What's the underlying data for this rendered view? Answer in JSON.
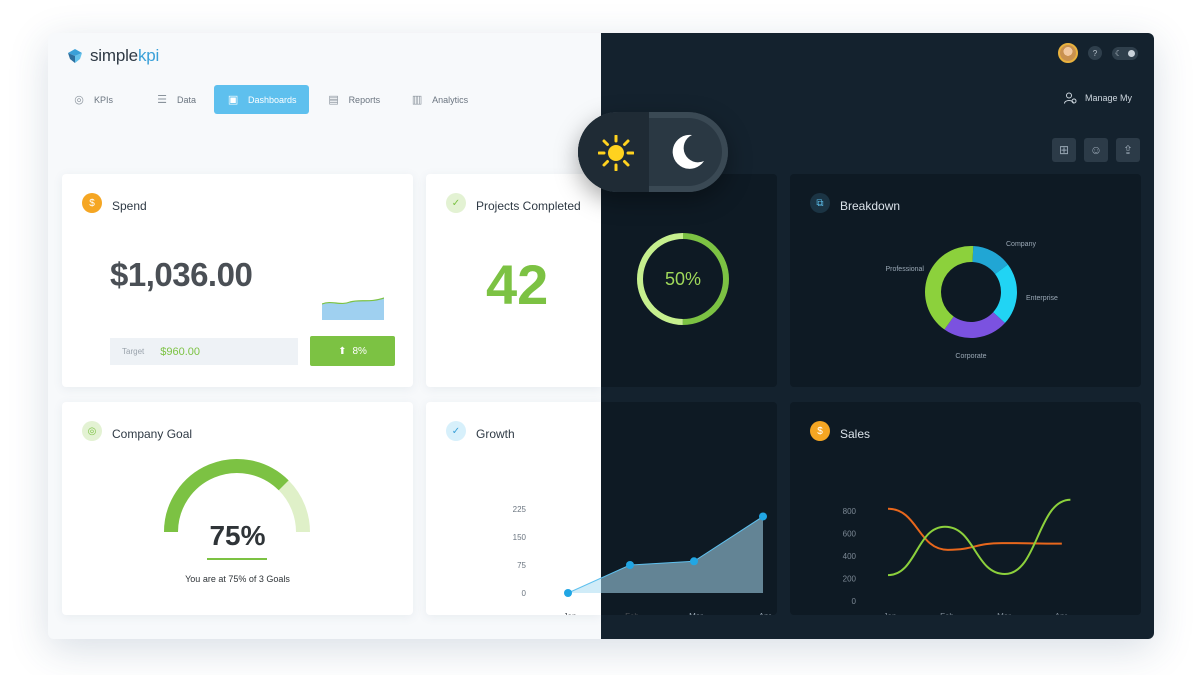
{
  "app": {
    "logo_simple": "simple",
    "logo_kpi": "kpi"
  },
  "nav": {
    "items": [
      {
        "label": "KPIs",
        "icon": "target-icon"
      },
      {
        "label": "Data",
        "icon": "data-icon"
      },
      {
        "label": "Dashboards",
        "icon": "dashboard-icon",
        "active": true
      },
      {
        "label": "Reports",
        "icon": "reports-icon"
      },
      {
        "label": "Analytics",
        "icon": "analytics-icon"
      }
    ]
  },
  "header": {
    "help": "?",
    "manage_label": "Manage My"
  },
  "colors": {
    "accent": "#5ec0ee",
    "green": "#7cc243",
    "orange": "#f5a623",
    "dark_bg": "#14222e",
    "dark_card": "#0e1a24",
    "cyan": "#21d4f4",
    "purple": "#7b52e0"
  },
  "spend": {
    "title": "Spend",
    "value": "$1,036.00",
    "target_label": "Target",
    "target_value": "$960.00",
    "change": "8%"
  },
  "projects": {
    "title": "Projects Completed",
    "value": "42",
    "percent_label": "50%",
    "percent": 50
  },
  "breakdown": {
    "title": "Breakdown"
  },
  "goal": {
    "title": "Company Goal",
    "percent_label": "75%",
    "percent": 75,
    "note": "You are at 75% of 3 Goals"
  },
  "growth": {
    "title": "Growth"
  },
  "sales": {
    "title": "Sales"
  },
  "chart_data": [
    {
      "type": "pie",
      "title": "Breakdown",
      "categories": [
        "Company",
        "Enterprise",
        "Corporate",
        "Professional"
      ],
      "values": [
        14,
        22,
        23,
        41
      ],
      "colors": [
        "#21a6d4",
        "#21d4f4",
        "#7b52e0",
        "#8cd13c"
      ]
    },
    {
      "type": "area",
      "title": "Growth",
      "categories": [
        "Jan",
        "Feb",
        "Mar",
        "Apr"
      ],
      "y_ticks": [
        "225",
        "150",
        "75",
        "0"
      ],
      "ylim": [
        0,
        225
      ],
      "values": [
        0,
        75,
        85,
        205
      ]
    },
    {
      "type": "line",
      "title": "Sales",
      "categories": [
        "Jan",
        "Feb",
        "Mar",
        "Apr"
      ],
      "y_ticks": [
        "800",
        "600",
        "400",
        "200",
        "0"
      ],
      "ylim": [
        0,
        800
      ],
      "series": [
        {
          "color": "#e8671c",
          "values": [
            820,
            455,
            515,
            510
          ],
          "x": [
            0,
            1.05,
            2.0,
            3.05
          ]
        },
        {
          "color": "#8cd13c",
          "values": [
            230,
            660,
            240,
            900
          ],
          "x": [
            0,
            1.0,
            2.05,
            3.2
          ]
        }
      ]
    }
  ]
}
